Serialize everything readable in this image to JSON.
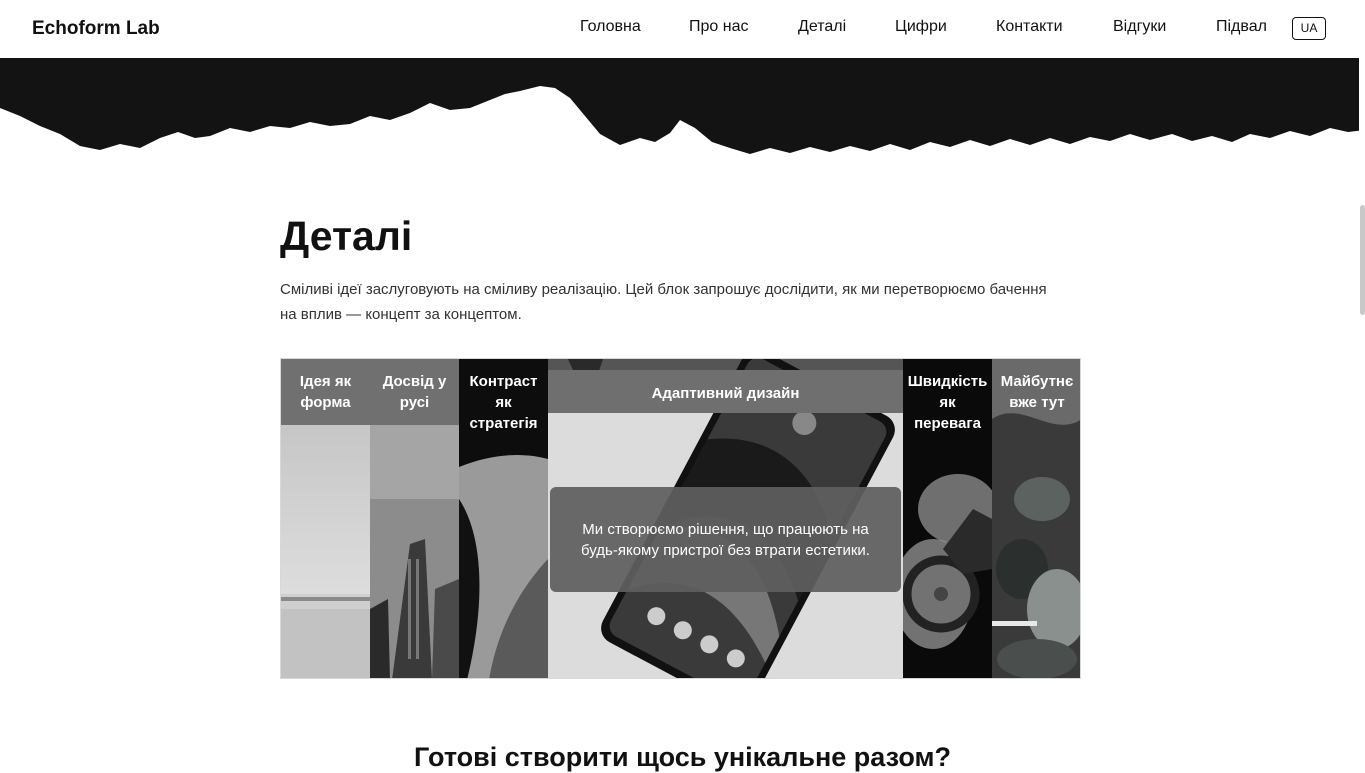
{
  "header": {
    "logo": "Echoform Lab",
    "nav": [
      "Головна",
      "Про нас",
      "Деталі",
      "Цифри",
      "Контакти",
      "Відгуки",
      "Підвал"
    ],
    "lang": "UA"
  },
  "details": {
    "title": "Деталі",
    "description": "Сміливі ідеї заслуговують на сміливу реалізацію. Цей блок запрошує дослідити, як ми перетворюємо бачення на вплив — концепт за концептом.",
    "panels": [
      {
        "label": "Ідея як форма"
      },
      {
        "label": "Досвід у русі"
      },
      {
        "label": "Контраст як стратегія"
      },
      {
        "label": "Адаптивний дизайн",
        "description": "Ми створюємо рішення, що працюють на будь-якому пристрої без втрати естетики."
      },
      {
        "label": "Швидкість як перевага"
      },
      {
        "label": "Майбутнє вже тут"
      }
    ]
  },
  "cta": {
    "title": "Готові створити щось унікальне разом?"
  }
}
